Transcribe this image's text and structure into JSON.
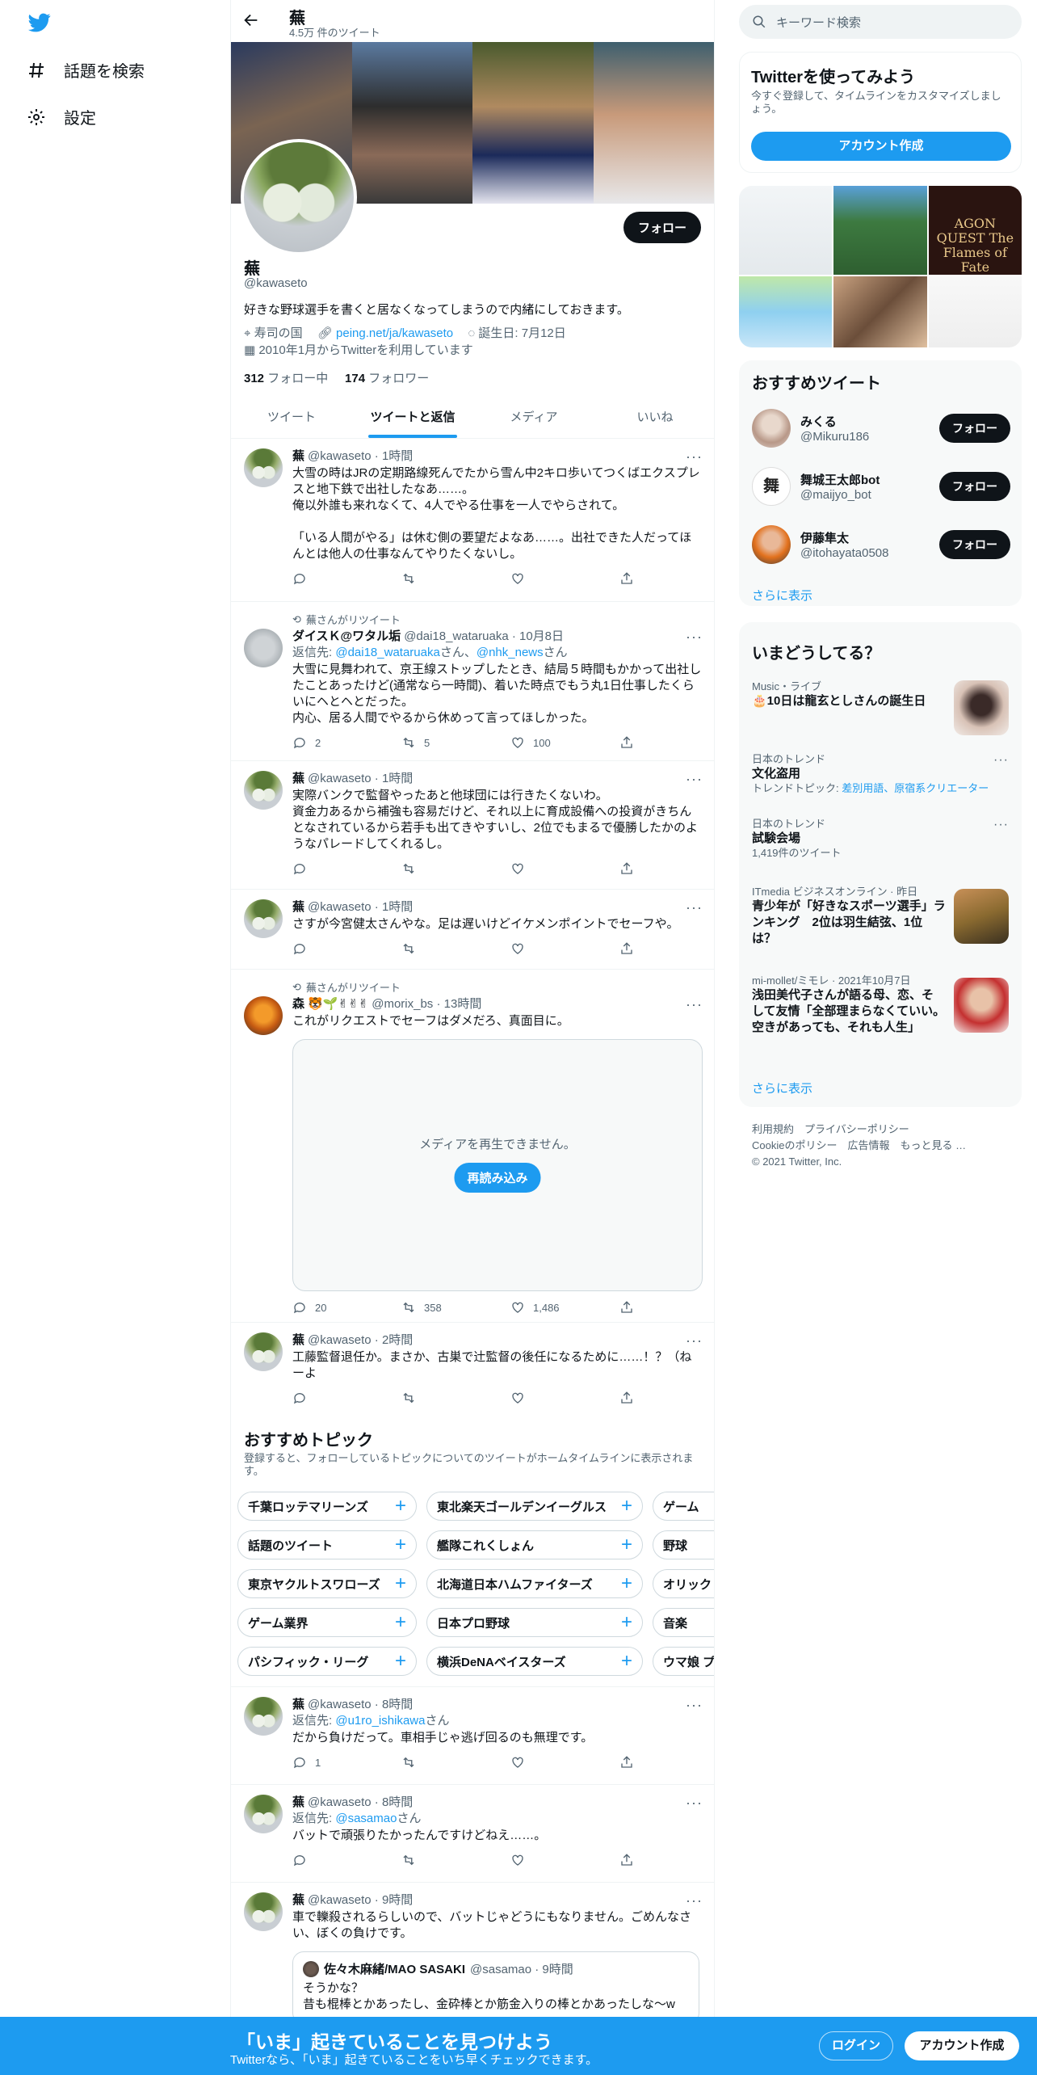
{
  "nav": {
    "items": [
      {
        "label": "話題を検索",
        "icon": "hashtag-icon"
      },
      {
        "label": "設定",
        "icon": "gear-icon"
      }
    ]
  },
  "header": {
    "title": "蕪",
    "tweet_count": "4.5万 件のツイート"
  },
  "profile": {
    "name": "蕪",
    "handle": "@kawaseto",
    "follow_label": "フォロー",
    "bio": "好きな野球選手を書くと居なくなってしまうので内緒にしておきます。",
    "location": "寿司の国",
    "link": "peing.net/ja/kawaseto",
    "birthday": "誕生日: 7月12日",
    "joined": "2010年1月からTwitterを利用しています",
    "following_count": "312",
    "following_label": " フォロー中",
    "followers_count": "174",
    "followers_label": " フォロワー"
  },
  "tabs": [
    "ツイート",
    "ツイートと返信",
    "メディア",
    "いいね"
  ],
  "tweets": [
    {
      "name": "蕪",
      "meta": "@kawaseto · 1時間",
      "text": "大雪の時はJRの定期路線死んでたから雪ん中2キロ歩いてつくばエクスプレスと地下鉄で出社したなあ……。\n俺以外誰も来れなくて、4人でやる仕事を一人でやらされて。\n\n「いる人間がやる」は休む側の要望だよなあ……。出社できた人だってほんとは他人の仕事なんてやりたくないし。",
      "reply": "",
      "retweets": "",
      "likes": ""
    },
    {
      "rt_label": "蕪さんがリツイート",
      "name": "ダイスＫ@ワタル垢",
      "meta": "@dai18_wataruaka · 10月8日",
      "reply_prefix": "返信先: ",
      "reply_to_1": "@dai18_wataruaka",
      "reply_mid": "さん、",
      "reply_to_2": "@nhk_news",
      "reply_suffix": "さん",
      "text": "大雪に見舞われて、京王線ストップしたとき、結局５時間もかかって出社したことあったけど(通常なら一時間)、着いた時点でもう丸1日仕事したくらいにヘとヘとだった。\n内心、居る人間でやるから休めって言ってほしかった。",
      "reply": "2",
      "retweets": "5",
      "likes": "100"
    },
    {
      "name": "蕪",
      "meta": "@kawaseto · 1時間",
      "text": "実際バンクで監督やったあと他球団には行きたくないわ。\n資金力あるから補強も容易だけど、それ以上に育成設備への投資がきちんとなされているから若手も出てきやすいし、2位でもまるで優勝したかのようなパレードしてくれるし。",
      "reply": "",
      "retweets": "",
      "likes": ""
    },
    {
      "name": "蕪",
      "meta": "@kawaseto · 1時間",
      "text": "さすが今宮健太さんやな。足は遅いけどイケメンポイントでセーフや。",
      "reply": "",
      "retweets": "",
      "likes": ""
    },
    {
      "rt_label": "蕪さんがリツイート",
      "name": "森 🐯🌱✌✌✌",
      "meta": "@morix_bs · 13時間",
      "text": "これがリクエストでセーフはダメだろ、真面目に。",
      "media_message": "メディアを再生できません。",
      "reload_label": "再読み込み",
      "reply": "20",
      "retweets": "358",
      "likes": "1,486"
    },
    {
      "name": "蕪",
      "meta": "@kawaseto · 2時間",
      "text": "工藤監督退任か。まさか、古巣で辻監督の後任になるために……！？（ねーよ",
      "reply": "",
      "retweets": "",
      "likes": ""
    },
    {
      "name": "蕪",
      "meta": "@kawaseto · 8時間",
      "reply_prefix": "返信先: ",
      "reply_to_1": "@u1ro_ishikawa",
      "reply_suffix": "さん",
      "text": "だから負けだって。車相手じゃ逃げ回るのも無理です。",
      "reply": "1",
      "retweets": "",
      "likes": ""
    },
    {
      "name": "蕪",
      "meta": "@kawaseto · 8時間",
      "reply_prefix": "返信先: ",
      "reply_to_1": "@sasamao",
      "reply_suffix": "さん",
      "text": "バットで頑張りたかったんですけどねえ……。",
      "reply": "",
      "retweets": "",
      "likes": ""
    },
    {
      "name": "蕪",
      "meta": "@kawaseto · 9時間",
      "text": "車で轢殺されるらしいので、バットじゃどうにもなりません。ごめんなさい、ぼくの負けです。",
      "quote_name": "佐々木麻緒/MAO SASAKI",
      "quote_meta": "@sasamao · 9時間",
      "quote_text": "そうかな？\n昔も棍棒とかあったし、金砕棒とか筋金入りの棒とかあったしな〜w"
    }
  ],
  "topics": {
    "title": "おすすめトピック",
    "desc": "登録すると、フォローしているトピックについてのツイートがホームタイムラインに表示されます。",
    "rows": [
      [
        "千葉ロッテマリーンズ",
        "東北楽天ゴールデンイーグルス",
        "ゲーム"
      ],
      [
        "話題のツイート",
        "艦隊これくしょん",
        "野球"
      ],
      [
        "東京ヤクルトスワローズ",
        "北海道日本ハムファイターズ",
        "オリック"
      ],
      [
        "ゲーム業界",
        "日本プロ野球",
        "音楽"
      ],
      [
        "パシフィック・リーグ",
        "横浜DeNAベイスターズ",
        "ウマ娘 プ"
      ]
    ]
  },
  "right": {
    "search_placeholder": "キーワード検索",
    "join_title": "Twitterを使ってみよう",
    "join_sub": "今すぐ登録して、タイムラインをカスタマイズしましょう。",
    "join_button": "アカウント作成",
    "grid_text": "AGON QUEST The Flames of Fate",
    "rec_title": "おすすめツイート",
    "rec_users": [
      {
        "name": "みくる",
        "handle": "@Mikuru186",
        "button": "フォロー"
      },
      {
        "name": "舞城王太郎bot",
        "handle": "@maijyo_bot",
        "button": "フォロー"
      },
      {
        "name": "伊藤隼太",
        "handle": "@itohayata0508",
        "button": "フォロー"
      }
    ],
    "show_more": "さらに表示",
    "trends_title": "いまどうしてる？",
    "trends": [
      {
        "cat": "Music・ライブ",
        "title": "🎂10日は龍玄としさんの誕生日",
        "extra": ""
      },
      {
        "cat": "日本のトレンド",
        "title": "文化盗用",
        "extra_prefix": "トレンドトピック: ",
        "extra_links": "差別用語、原宿系クリエーター"
      },
      {
        "cat": "日本のトレンド",
        "title": "試験会場",
        "extra": "1,419件のツイート"
      },
      {
        "cat": "ITmedia ビジネスオンライン · 昨日",
        "title": "青少年が「好きなスポーツ選手」ランキング　2位は羽生結弦、1位は？"
      },
      {
        "cat": "mi-mollet/ミモレ · 2021年10月7日",
        "title": "浅田美代子さんが語る母、恋、そして友情「全部理まらなくていい。空きがあっても、それも人生」"
      }
    ],
    "show_more2": "さらに表示",
    "footer_line1": "利用規約　プライバシーポリシー",
    "footer_line2": "Cookieのポリシー　広告情報　もっと見る …",
    "footer_line3": "© 2021 Twitter, Inc."
  },
  "bottom": {
    "headline": "「いま」起きていることを見つけよう",
    "sub": "Twitterなら、「いま」起きていることをいち早くチェックできます。",
    "login": "ログイン",
    "signup": "アカウント作成"
  },
  "colors": {
    "accent": "#1d9bf0",
    "text": "#0f1419",
    "muted": "#536471"
  }
}
